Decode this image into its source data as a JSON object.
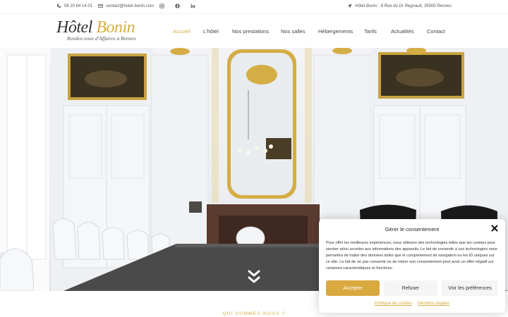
{
  "topbar": {
    "phone": "06 20 84 14 01",
    "email": "contact@hotel-bonin.com",
    "address": "Hôtel Bonin - 8 Rue du Dr Regnault, 35000 Rennes",
    "icons": [
      "phone-icon",
      "mail-icon",
      "instagram-icon",
      "facebook-icon",
      "linkedin-icon",
      "location-arrow-icon"
    ]
  },
  "logo": {
    "word1": "Hôtel",
    "word2": "Bonin",
    "tagline": "Rendez-vous d'Affaires à Rennes"
  },
  "nav": {
    "items": [
      {
        "label": "Accueil",
        "active": true
      },
      {
        "label": "L'hôtel"
      },
      {
        "label": "Nos prestations"
      },
      {
        "label": "Nos salles"
      },
      {
        "label": "Hébergements"
      },
      {
        "label": "Tarifs"
      },
      {
        "label": "Actualités"
      },
      {
        "label": "Contact"
      }
    ]
  },
  "hero": {
    "scroll_icon": "double-chevron-down-icon"
  },
  "section": {
    "label": "QUI SOMMES-NOUS ?"
  },
  "consent": {
    "title": "Gérer le consentement",
    "text": "Pour offrir les meilleures expériences, nous utilisons des technologies telles que les cookies pour stocker et/ou accéder aux informations des appareils. Le fait de consentir à ces technologies nous permettra de traiter des données telles que le comportement de navigation ou les ID uniques sur ce site. Le fait de ne pas consentir ou de retirer son consentement peut avoir un effet négatif sur certaines caractéristiques et fonctions.",
    "accept": "Accepter",
    "refuse": "Refuser",
    "prefs": "Voir les préférences",
    "link_cookies": "Politique de cookies",
    "link_legal": "Mentions légales"
  },
  "colors": {
    "accent": "#d4ad45",
    "accept_button": "#d9a93f"
  }
}
